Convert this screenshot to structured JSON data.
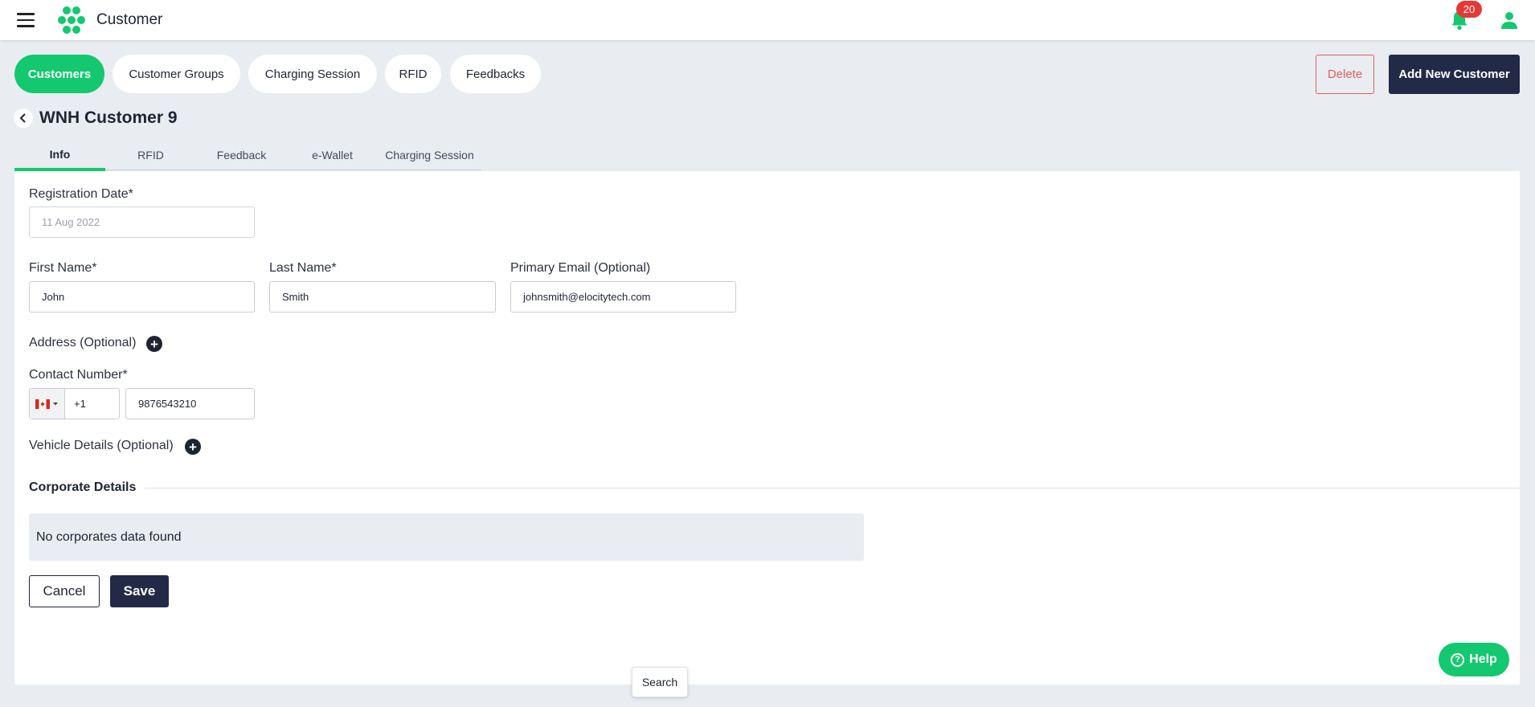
{
  "header": {
    "app_title": "Customer",
    "notification_count": "20",
    "icons": {
      "menu": "hamburger-icon",
      "logo": "hexagon-cluster-logo",
      "bell": "bell-icon",
      "user": "user-icon"
    },
    "brand_color": "#13c86f",
    "dark_color": "#232a47"
  },
  "nav": {
    "pills": [
      {
        "label": "Customers",
        "active": true
      },
      {
        "label": "Customer Groups",
        "active": false
      },
      {
        "label": "Charging Session",
        "active": false
      },
      {
        "label": "RFID",
        "active": false
      },
      {
        "label": "Feedbacks",
        "active": false
      }
    ],
    "delete_label": "Delete",
    "add_label": "Add New Customer"
  },
  "page": {
    "title": "WNH Customer 9",
    "tabs": [
      "Info",
      "RFID",
      "Feedback",
      "e-Wallet",
      "Charging Session"
    ],
    "active_tab": "Info"
  },
  "form": {
    "registration_date": {
      "label": "Registration Date*",
      "value": "11 Aug 2022"
    },
    "first_name": {
      "label": "First Name*",
      "value": "John"
    },
    "last_name": {
      "label": "Last Name*",
      "value": "Smith"
    },
    "email": {
      "label": "Primary Email (Optional)",
      "value": "johnsmith@elocitytech.com"
    },
    "address": {
      "label": "Address (Optional)"
    },
    "contact": {
      "label": "Contact Number*",
      "country": "Canada",
      "dial_code": "+1",
      "number": "9876543210"
    },
    "vehicle": {
      "label": "Vehicle Details (Optional)"
    },
    "corporate": {
      "heading": "Corporate Details",
      "empty_text": "No corporates data found"
    },
    "cancel_label": "Cancel",
    "save_label": "Save"
  },
  "help_label": "Help",
  "search_tooltip": "Search"
}
